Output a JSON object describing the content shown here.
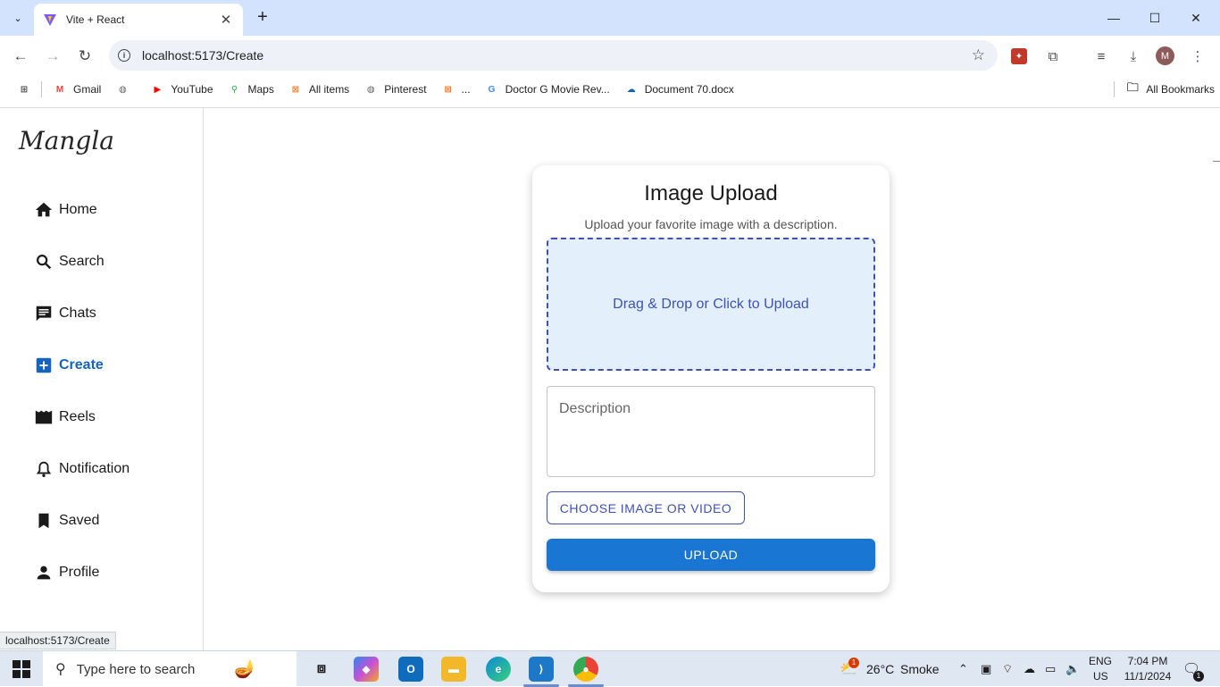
{
  "browser": {
    "tab_title": "Vite + React",
    "tab_close": "✕",
    "new_tab": "+",
    "url": "localhost:5173/Create",
    "bookmarks": [
      {
        "label": "Gmail",
        "icon": "gmail-icon",
        "color": "#ea4335",
        "glyph": "M"
      },
      {
        "label": "",
        "icon": "globe-icon",
        "color": "#5f6368",
        "glyph": "◍"
      },
      {
        "label": "YouTube",
        "icon": "youtube-icon",
        "color": "#ff0000",
        "glyph": "▶"
      },
      {
        "label": "Maps",
        "icon": "maps-pin-icon",
        "color": "#34a853",
        "glyph": "⚲"
      },
      {
        "label": "All items",
        "icon": "xampp-icon",
        "color": "#fb7a24",
        "glyph": "⊠"
      },
      {
        "label": "Pinterest",
        "icon": "globe-icon",
        "color": "#5f6368",
        "glyph": "◍"
      },
      {
        "label": "...",
        "icon": "xampp-icon",
        "color": "#fb7a24",
        "glyph": "⊠"
      },
      {
        "label": "Doctor G Movie Rev...",
        "icon": "google-icon",
        "color": "#4285f4",
        "glyph": "G"
      },
      {
        "label": "Document 70.docx",
        "icon": "onedrive-icon",
        "color": "#0a64c8",
        "glyph": "☁"
      }
    ],
    "all_bookmarks": "All Bookmarks",
    "status_tooltip": "localhost:5173/Create",
    "profile_initial": "M"
  },
  "sidebar": {
    "brand": "Mangla",
    "items": [
      {
        "label": "Home",
        "icon": "home-icon",
        "active": false
      },
      {
        "label": "Search",
        "icon": "search-icon",
        "active": false
      },
      {
        "label": "Chats",
        "icon": "chat-icon",
        "active": false
      },
      {
        "label": "Create",
        "icon": "add-box-icon",
        "active": true
      },
      {
        "label": "Reels",
        "icon": "movie-icon",
        "active": false
      },
      {
        "label": "Notification",
        "icon": "bell-icon",
        "active": false
      },
      {
        "label": "Saved",
        "icon": "bookmark-icon",
        "active": false
      },
      {
        "label": "Profile",
        "icon": "person-icon",
        "active": false
      }
    ]
  },
  "upload": {
    "title": "Image Upload",
    "subtitle": "Upload your favorite image with a description.",
    "dropzone_text": "Drag & Drop or Click to Upload",
    "description_placeholder": "Description",
    "choose_label": "CHOOSE IMAGE OR VIDEO",
    "upload_label": "UPLOAD"
  },
  "taskbar": {
    "search_placeholder": "Type here to search",
    "weather_temp": "26°C",
    "weather_desc": "Smoke",
    "weather_badge": "1",
    "lang": "ENG",
    "region": "US",
    "time": "7:04 PM",
    "date": "11/1/2024",
    "notification_count": "1"
  },
  "colors": {
    "accent": "#1976d2",
    "active_nav": "#1565c0",
    "dropzone_border": "#3f51b5",
    "dropzone_bg": "#e3f0fc",
    "tabstrip_bg": "#d3e3fd"
  }
}
